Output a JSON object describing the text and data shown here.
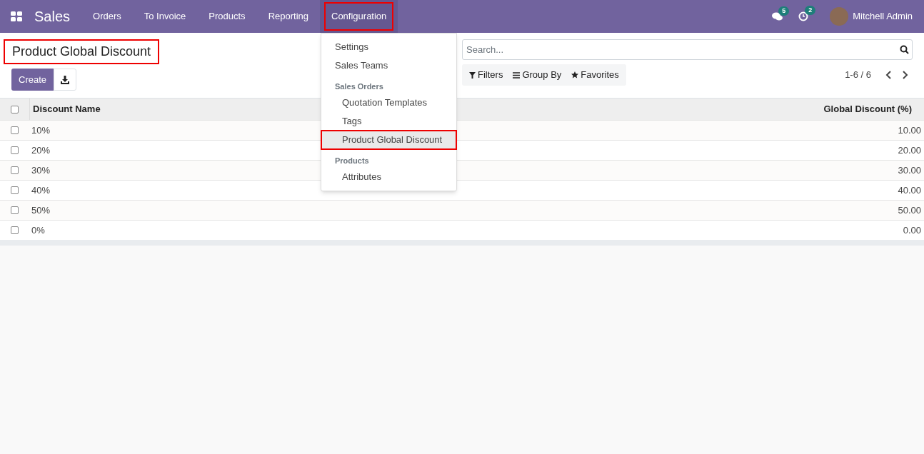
{
  "navbar": {
    "app_name": "Sales",
    "menus": [
      {
        "label": "Orders",
        "selected": false,
        "highlighted": false
      },
      {
        "label": "To Invoice",
        "selected": false,
        "highlighted": false
      },
      {
        "label": "Products",
        "selected": false,
        "highlighted": false
      },
      {
        "label": "Reporting",
        "selected": false,
        "highlighted": false
      },
      {
        "label": "Configuration",
        "selected": true,
        "highlighted": true
      }
    ],
    "messages_count": "5",
    "activities_count": "2",
    "user": "Mitchell Admin"
  },
  "dropdown": [
    {
      "kind": "item",
      "label": "Settings",
      "selected": false,
      "highlighted": false
    },
    {
      "kind": "item",
      "label": "Sales Teams",
      "selected": false,
      "highlighted": false
    },
    {
      "kind": "section",
      "label": "Sales Orders",
      "children": [
        {
          "label": "Quotation Templates",
          "selected": false,
          "highlighted": false
        },
        {
          "label": "Tags",
          "selected": false,
          "highlighted": false
        },
        {
          "label": "Product Global Discount",
          "selected": true,
          "highlighted": true
        }
      ]
    },
    {
      "kind": "section",
      "label": "Products",
      "children": [
        {
          "label": "Attributes",
          "selected": false,
          "highlighted": false
        }
      ]
    }
  ],
  "page": {
    "title": "Product Global Discount",
    "title_highlighted": true,
    "create_button": "Create"
  },
  "search": {
    "placeholder": "Search...",
    "filters": [
      "Filters",
      "Group By",
      "Favorites"
    ],
    "pager": "1-6 / 6"
  },
  "table": {
    "header_checked": false,
    "columns": [
      "Discount Name",
      "Global Discount (%)"
    ],
    "rows": [
      {
        "name": "10%",
        "value": "10.00",
        "checked": false
      },
      {
        "name": "20%",
        "value": "20.00",
        "checked": false
      },
      {
        "name": "30%",
        "value": "30.00",
        "checked": false
      },
      {
        "name": "40%",
        "value": "40.00",
        "checked": false
      },
      {
        "name": "50%",
        "value": "50.00",
        "checked": false
      },
      {
        "name": "0%",
        "value": "0.00",
        "checked": false
      }
    ]
  }
}
